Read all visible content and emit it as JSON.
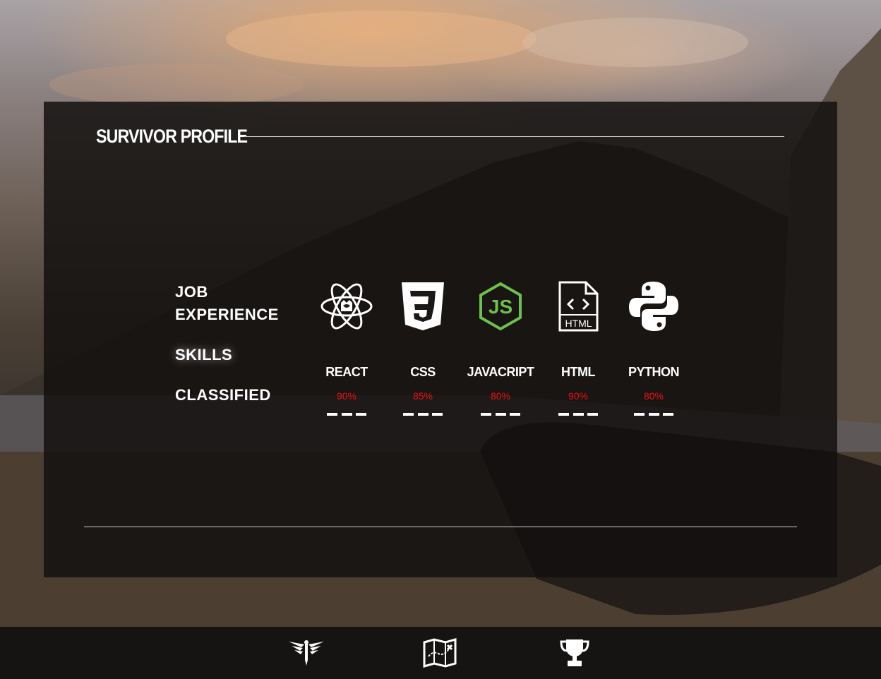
{
  "panel": {
    "title": "SURVIVOR PROFILE"
  },
  "menu": {
    "job_line1": "JOB",
    "job_line2": "EXPERIENCE",
    "skills": "SKILLS",
    "classified": "CLASSIFIED"
  },
  "skills": [
    {
      "name": "REACT",
      "percent": "90%",
      "icon": "react-icon"
    },
    {
      "name": "CSS",
      "percent": "85%",
      "icon": "css3-icon"
    },
    {
      "name": "JAVACRIPT",
      "percent": "80%",
      "icon": "nodejs-icon"
    },
    {
      "name": "HTML",
      "percent": "90%",
      "icon": "html-file-icon"
    },
    {
      "name": "PYTHON",
      "percent": "80%",
      "icon": "python-icon"
    }
  ],
  "footer": {
    "buttons": [
      {
        "icon": "firefly-emblem-icon"
      },
      {
        "icon": "map-icon"
      },
      {
        "icon": "trophy-icon"
      }
    ]
  },
  "colors": {
    "percent_text": "#e11111",
    "node_green": "#6cc24a",
    "panel_bg": "#12100e"
  }
}
